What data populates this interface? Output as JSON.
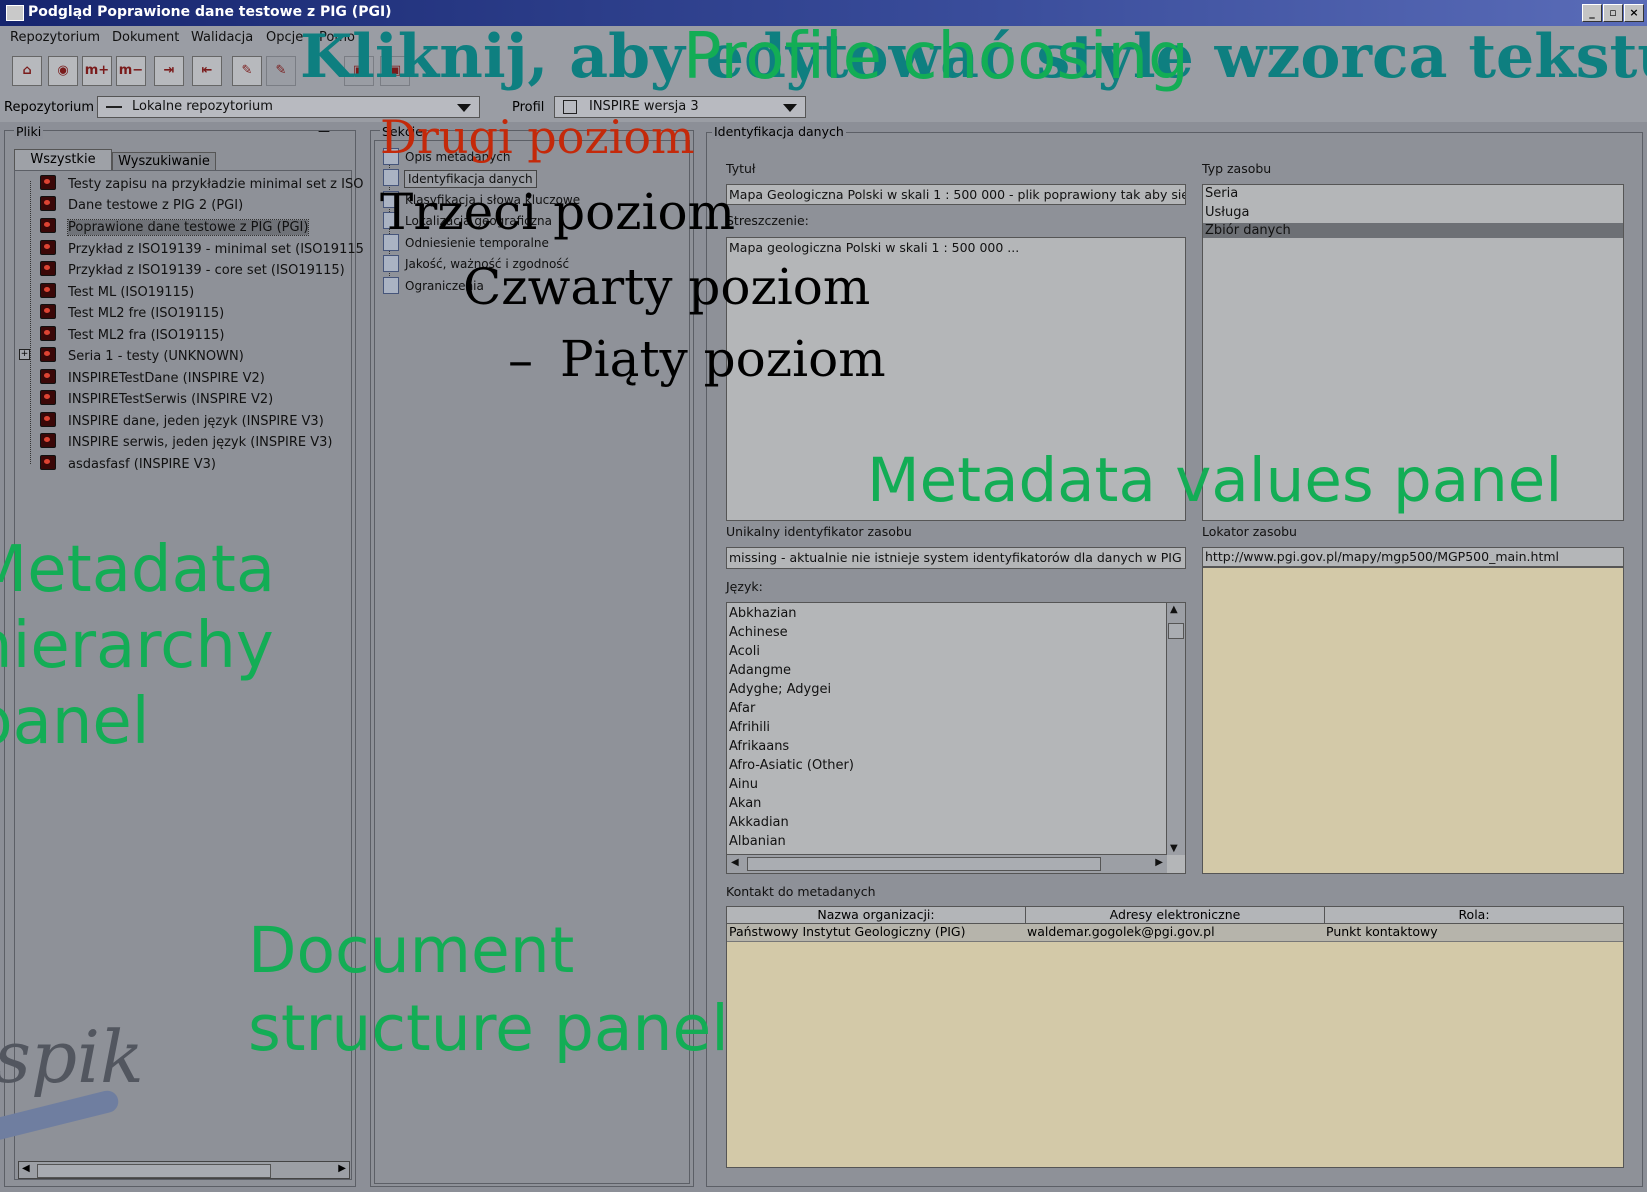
{
  "window": {
    "title": "Podgląd Poprawione dane testowe z PIG (PGI)"
  },
  "menu": [
    "Repozytorium",
    "Dokument",
    "Walidacja",
    "Opcje",
    "Pomo"
  ],
  "selectors": {
    "repo_label": "Repozytorium",
    "repo_value": "Lokalne repozytorium",
    "profile_label": "Profil",
    "profile_value": "INSPIRE wersja 3"
  },
  "files_panel": {
    "title": "Pliki",
    "tabs": [
      "Wszystkie",
      "Wyszukiwanie"
    ],
    "items": [
      "Testy zapisu na przykładzie minimal set z ISO",
      "Dane testowe z PIG 2 (PGI)",
      "Poprawione dane testowe z PIG (PGI)",
      "Przykład z ISO19139 - minimal set (ISO19115",
      "Przykład z ISO19139 - core set (ISO19115)",
      "Test ML (ISO19115)",
      "Test ML2 fre (ISO19115)",
      "Test ML2 fra (ISO19115)",
      "Seria 1 - testy (UNKNOWN)",
      "INSPIRETestDane (INSPIRE V2)",
      "INSPIRETestSerwis (INSPIRE V2)",
      "INSPIRE dane, jeden język (INSPIRE V3)",
      "INSPIRE serwis, jeden język (INSPIRE V3)",
      "asdasfasf (INSPIRE V3)"
    ]
  },
  "sections_panel": {
    "title": "Sekcje",
    "items": [
      "Opis metadanych",
      "Identyfikacja danych",
      "Klasyfikacja i słowa kluczowe",
      "Lokalizacja geograficzna",
      "Odniesienie temporalne",
      "Jakość, ważność i zgodność",
      "Ograniczenia"
    ]
  },
  "identification": {
    "group_title": "Identyfikacja danych",
    "title_label": "Tytuł",
    "title_value": "Mapa Geologiczna Polski w skali 1 : 500 000 - plik poprawiony tak aby się w",
    "abstract_label": "Streszczenie:",
    "abstract_value": "Mapa geologiczna Polski w skali 1 : 500 000 ...",
    "resource_type_label": "Typ zasobu",
    "resource_types": [
      "Seria",
      "Usługa",
      "Zbiór danych"
    ],
    "uid_label": "Unikalny identyfikator zasobu",
    "uid_value": "missing - aktualnie nie istnieje system identyfikatorów dla danych w PIG",
    "locator_label": "Lokator zasobu",
    "locator_value": "http://www.pgi.gov.pl/mapy/mgp500/MGP500_main.html",
    "language_label": "Język:",
    "languages": [
      "Abkhazian",
      "Achinese",
      "Acoli",
      "Adangme",
      "Adyghe; Adygei",
      "Afar",
      "Afrihili",
      "Afrikaans",
      "Afro-Asiatic (Other)",
      "Ainu",
      "Akan",
      "Akkadian",
      "Albanian"
    ],
    "contact_label": "Kontakt do metadanych",
    "contact_headers": [
      "Nazwa organizacji:",
      "Adresy elektroniczne",
      "Rola:"
    ],
    "contact_row": [
      "Państwowy Instytut Geologiczny (PIG)",
      "waldemar.gogolek@pgi.gov.pl",
      "Punkt kontaktowy"
    ]
  },
  "overlay": {
    "title_dark": "Kliknij, aby edytować style wzorca tekstu",
    "title_green": "Profile choosing",
    "level2": "Drugi poziom",
    "level3": "Trzeci poziom",
    "level4": "Czwarty poziom",
    "level5": "Piąty poziom",
    "bullet5": "–",
    "label_metadata_values": "Metadata values panel",
    "label_hierarchy_1": "Metadata",
    "label_hierarchy_2": "hierarchy",
    "label_hierarchy_3": "panel",
    "label_docstruct_1": "Document",
    "label_docstruct_2": "structure panel",
    "logo_text": "spik"
  },
  "colors": {
    "overlay_green": "#13ad55",
    "title_teal": "#0e7f80",
    "level2_red": "#c4290a"
  }
}
